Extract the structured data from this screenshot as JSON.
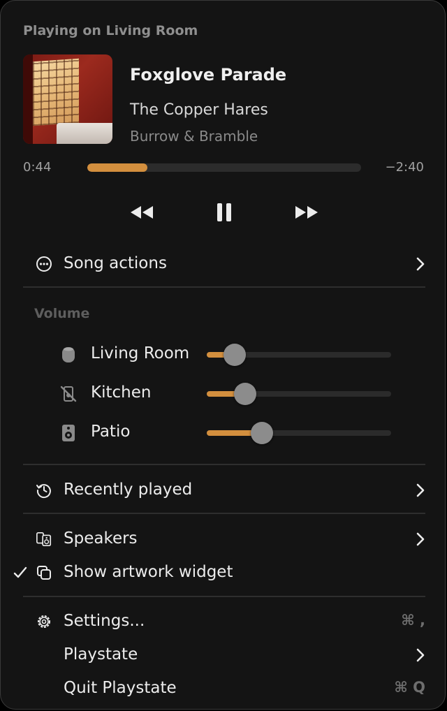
{
  "header": {
    "title": "Playing on Living Room"
  },
  "now_playing": {
    "title": "Foxglove Parade",
    "artist": "The Copper Hares",
    "album": "Burrow & Bramble",
    "elapsed": "0:44",
    "remaining": "−2:40",
    "progress_fraction": 0.22
  },
  "controls": {
    "previous_icon": "rewind-icon",
    "pause_icon": "pause-icon",
    "next_icon": "fast-forward-icon"
  },
  "menu": {
    "song_actions": "Song actions",
    "recently_played": "Recently played",
    "speakers": "Speakers",
    "show_artwork_widget": "Show artwork widget",
    "settings": "Settings...",
    "settings_shortcut": "⌘ ,",
    "playstate": "Playstate",
    "quit": "Quit Playstate",
    "quit_shortcut": "⌘ Q"
  },
  "volume": {
    "heading": "Volume",
    "rooms": [
      {
        "name": "Living Room",
        "level": 0.15,
        "icon": "homepod-icon"
      },
      {
        "name": "Kitchen",
        "level": 0.21,
        "icon": "speaker-muted-icon"
      },
      {
        "name": "Patio",
        "level": 0.3,
        "icon": "speaker-icon"
      }
    ]
  },
  "colors": {
    "accent": "#d38f3e",
    "background": "#141414",
    "knob": "#8c8c8c"
  }
}
